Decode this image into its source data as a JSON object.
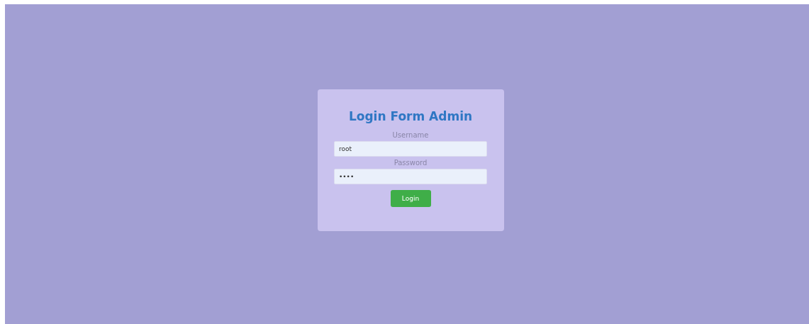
{
  "form": {
    "title": "Login Form Admin",
    "fields": [
      {
        "label": "Username",
        "value": "root"
      },
      {
        "label": "Password",
        "value": "••••"
      }
    ],
    "button": "Login"
  }
}
